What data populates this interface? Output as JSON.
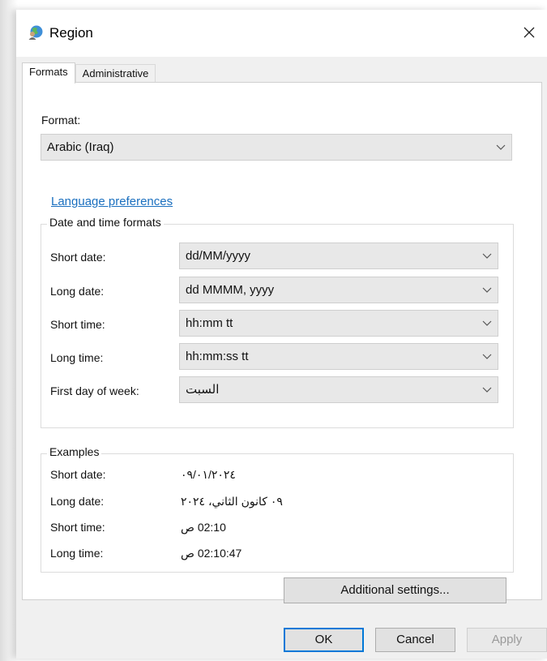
{
  "window": {
    "title": "Region",
    "close_glyph": "✕"
  },
  "tabs": [
    {
      "label": "Formats",
      "active": true
    },
    {
      "label": "Administrative",
      "active": false
    }
  ],
  "formats": {
    "format_label": "Format:",
    "format_value": "Arabic (Iraq)",
    "language_link": "Language preferences"
  },
  "date_time_formats": {
    "title": "Date and time formats",
    "rows": [
      {
        "label": "Short date:",
        "value": "dd/MM/yyyy"
      },
      {
        "label": "Long date:",
        "value": "dd MMMM, yyyy"
      },
      {
        "label": "Short time:",
        "value": "hh:mm tt"
      },
      {
        "label": "Long time:",
        "value": "hh:mm:ss tt"
      },
      {
        "label": "First day of week:",
        "value": "السبت"
      }
    ]
  },
  "examples": {
    "title": "Examples",
    "rows": [
      {
        "label": "Short date:",
        "value": "٠٩/٠١/٢٠٢٤"
      },
      {
        "label": "Long date:",
        "value": "٠٩ كانون الثاني، ٢٠٢٤"
      },
      {
        "label": "Short time:",
        "value": "02:10 ص"
      },
      {
        "label": "Long time:",
        "value": "02:10:47 ص"
      }
    ]
  },
  "buttons": {
    "additional_settings": "Additional settings...",
    "ok": "OK",
    "cancel": "Cancel",
    "apply": "Apply"
  },
  "colors": {
    "link": "#1a6fbf",
    "accent_border": "#0078d7"
  },
  "icons": {
    "title_icon": "globe-person-icon",
    "dropdown_icon": "chevron-down-icon",
    "close_icon": "close-icon"
  }
}
